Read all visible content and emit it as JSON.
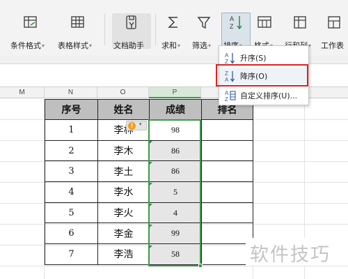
{
  "ribbon": {
    "buttons": [
      {
        "label": "条件格式",
        "icon": "conditional-format-icon",
        "caret": "▾"
      },
      {
        "label": "表格样式",
        "icon": "table-style-icon",
        "caret": "▾"
      },
      {
        "label": "文档助手",
        "icon": "document-assistant-icon",
        "caret": ""
      },
      {
        "label": "求和",
        "icon": "sum-icon",
        "caret": "▾"
      },
      {
        "label": "筛选",
        "icon": "filter-icon",
        "caret": "▾"
      },
      {
        "label": "排序",
        "icon": "sort-icon",
        "caret": "▾"
      },
      {
        "label": "格式",
        "icon": "format-icon",
        "caret": "▾"
      },
      {
        "label": "行和列",
        "icon": "rows-columns-icon",
        "caret": "▾"
      },
      {
        "label": "工作表",
        "icon": "worksheet-icon",
        "caret": ""
      }
    ]
  },
  "sort_menu": {
    "items": [
      {
        "label": "升序(S)",
        "icon": "sort-ascending-icon"
      },
      {
        "label": "降序(O)",
        "icon": "sort-descending-icon"
      },
      {
        "label": "自定义排序(U)...",
        "icon": "custom-sort-icon"
      }
    ]
  },
  "grid": {
    "column_headers": [
      "M",
      "N",
      "O",
      "P",
      "Q"
    ]
  },
  "table": {
    "headers": [
      "序号",
      "姓名",
      "成绩",
      "排名"
    ],
    "rows": [
      {
        "no": "1",
        "name": "李林",
        "score": "98",
        "rank": ""
      },
      {
        "no": "2",
        "name": "李木",
        "score": "86",
        "rank": ""
      },
      {
        "no": "3",
        "name": "李土",
        "score": "86",
        "rank": ""
      },
      {
        "no": "4",
        "name": "李水",
        "score": "5",
        "rank": ""
      },
      {
        "no": "5",
        "name": "李火",
        "score": "4",
        "rank": ""
      },
      {
        "no": "6",
        "name": "李金",
        "score": "99",
        "rank": ""
      },
      {
        "no": "7",
        "name": "李浩",
        "score": "58",
        "rank": ""
      }
    ]
  },
  "warning": {
    "symbol": "!",
    "dropdown": "▾"
  },
  "watermark": "软件技巧",
  "colors": {
    "selection_green": "#3c9a4a",
    "highlight_red": "#e02020",
    "header_gray": "#bfbfbf",
    "ribbon_bg": "#f3f3f3"
  }
}
